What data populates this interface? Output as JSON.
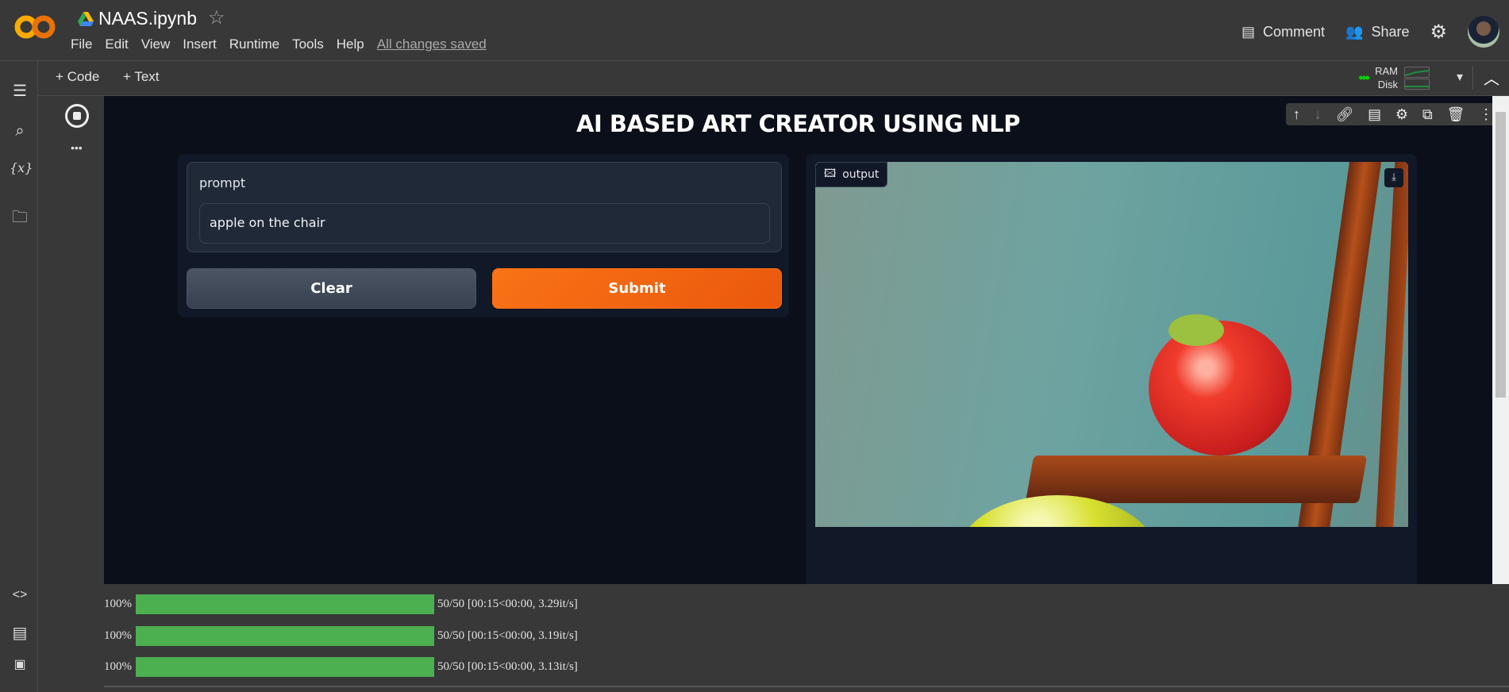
{
  "header": {
    "notebook_title": "NAAS.ipynb",
    "menu": [
      "File",
      "Edit",
      "View",
      "Insert",
      "Runtime",
      "Tools",
      "Help"
    ],
    "save_status": "All changes saved",
    "comment_label": "Comment",
    "share_label": "Share"
  },
  "toolbar": {
    "add_code": "+ Code",
    "add_text": "+ Text",
    "ram_label": "RAM",
    "disk_label": "Disk"
  },
  "app": {
    "title": "AI BASED ART CREATOR USING NLP",
    "prompt_label": "prompt",
    "prompt_value": "apple on the chair",
    "clear_label": "Clear",
    "submit_label": "Submit",
    "output_label": "output"
  },
  "progress": [
    {
      "percent_label": "100%",
      "fraction": 1.0,
      "info": "50/50 [00:15<00:00, 3.29it/s]"
    },
    {
      "percent_label": "100%",
      "fraction": 1.0,
      "info": "50/50 [00:15<00:00, 3.19it/s]"
    },
    {
      "percent_label": "100%",
      "fraction": 1.0,
      "info": "50/50 [00:15<00:00, 3.13it/s]"
    }
  ],
  "colors": {
    "accent": "#f97316",
    "progress": "#4caf50",
    "background": "#0b0f19"
  }
}
